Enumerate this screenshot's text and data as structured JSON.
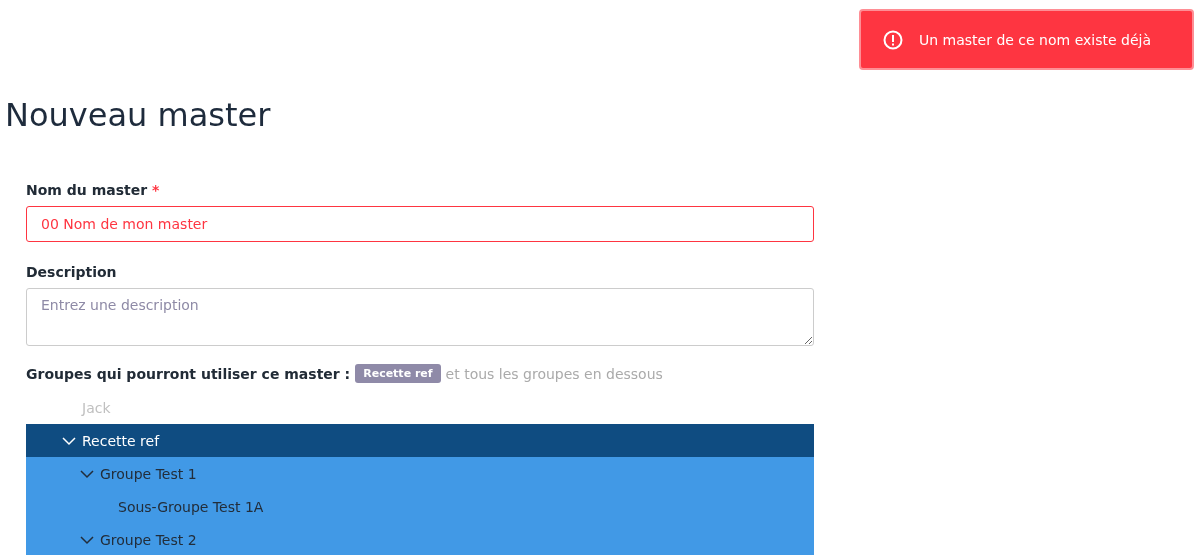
{
  "toast": {
    "message": "Un master de ce nom existe déjà"
  },
  "title": "Nouveau master",
  "form": {
    "name_field": {
      "label": "Nom du master",
      "required_mark": "*",
      "value": "00 Nom de mon master",
      "invalid": true
    },
    "description_field": {
      "label": "Description",
      "placeholder": "Entrez une description"
    },
    "groups": {
      "label": "Groupes qui pourront utiliser ce master :",
      "badge": "Recette ref",
      "suffix": "et tous les groupes en dessous"
    }
  },
  "tree": [
    {
      "label": "Jack",
      "disabled": true,
      "selected": false,
      "expanded": false
    },
    {
      "label": "Recette ref",
      "selected": true,
      "expanded": true,
      "children": [
        {
          "label": "Groupe Test 1",
          "selected": false,
          "expanded": true,
          "children": [
            {
              "label": "Sous-Groupe Test 1A",
              "selected": false,
              "expanded": false
            }
          ]
        },
        {
          "label": "Groupe Test 2",
          "selected": false,
          "expanded": true
        }
      ]
    }
  ]
}
